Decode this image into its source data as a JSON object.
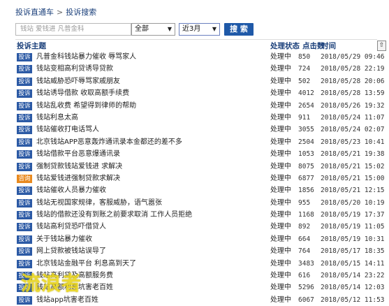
{
  "breadcrumb": {
    "root": "投诉直通车",
    "separator": ">",
    "current": "投诉搜索"
  },
  "search": {
    "placeholder": "钱站 爱钱进 凡普金科",
    "category": "全部",
    "range": "近3月",
    "button": "搜 索"
  },
  "headers": {
    "topic": "投诉主题",
    "status": "处理状态",
    "clicks": "点击数",
    "time": "时间"
  },
  "rows": [
    {
      "badge": "投诉",
      "title": "凡普金科钱站暴力催收 辱骂家人",
      "status": "处理中",
      "clicks": "850",
      "time": "2018/05/29 09:46"
    },
    {
      "badge": "投诉",
      "title": "钱站变相高利贷诱导贷款",
      "status": "处理中",
      "clicks": "724",
      "time": "2018/05/28 22:19"
    },
    {
      "badge": "投诉",
      "title": "钱站威胁恐吓辱骂家戚朋友",
      "status": "处理中",
      "clicks": "502",
      "time": "2018/05/28 20:06"
    },
    {
      "badge": "投诉",
      "title": "钱站诱导借款 收取高额手续费",
      "status": "处理中",
      "clicks": "4012",
      "time": "2018/05/28 13:59"
    },
    {
      "badge": "投诉",
      "title": "钱站乱收费 希望得到律师的帮助",
      "status": "处理中",
      "clicks": "2654",
      "time": "2018/05/26 19:32"
    },
    {
      "badge": "投诉",
      "title": "钱站利息太高",
      "status": "处理中",
      "clicks": "911",
      "time": "2018/05/24 11:07"
    },
    {
      "badge": "投诉",
      "title": "钱站催收打电话骂人",
      "status": "处理中",
      "clicks": "3055",
      "time": "2018/05/24 02:07"
    },
    {
      "badge": "投诉",
      "title": "北京钱站APP恶意轰炸通讯录本金都还的差不多",
      "status": "处理中",
      "clicks": "2504",
      "time": "2018/05/23 10:41"
    },
    {
      "badge": "投诉",
      "title": "钱站借款平台恶意爆通讯录",
      "status": "处理中",
      "clicks": "1053",
      "time": "2018/05/21 19:38"
    },
    {
      "badge": "投诉",
      "title": "强制贷款钱站爱钱进 求解决",
      "status": "处理中",
      "clicks": "8075",
      "time": "2018/05/21 15:02"
    },
    {
      "badge": "咨询",
      "title": "钱站爱钱进强制贷款求解决",
      "status": "处理中",
      "clicks": "6877",
      "time": "2018/05/21 15:00"
    },
    {
      "badge": "投诉",
      "title": "钱站催收人员暴力催收",
      "status": "处理中",
      "clicks": "1856",
      "time": "2018/05/21 12:15"
    },
    {
      "badge": "投诉",
      "title": "钱站无视国家规律，客服威胁，语气嚣张",
      "status": "处理中",
      "clicks": "955",
      "time": "2018/05/20 10:19"
    },
    {
      "badge": "投诉",
      "title": "钱站的借款还没有到账之前要求取消 工作人员拒绝",
      "status": "处理中",
      "clicks": "1168",
      "time": "2018/05/19 17:37"
    },
    {
      "badge": "投诉",
      "title": "钱站高利贷恐吓借贷人",
      "status": "处理中",
      "clicks": "892",
      "time": "2018/05/19 11:05"
    },
    {
      "badge": "投诉",
      "title": "关于钱站暴力催收",
      "status": "处理中",
      "clicks": "664",
      "time": "2018/05/19 10:31"
    },
    {
      "badge": "投诉",
      "title": "网上贷款被钱站误导了",
      "status": "处理中",
      "clicks": "764",
      "time": "2018/05/17 18:35"
    },
    {
      "badge": "投诉",
      "title": "北京钱站金融平台 利息高到天了",
      "status": "处理中",
      "clicks": "3483",
      "time": "2018/05/15 14:11"
    },
    {
      "badge": "投诉",
      "title": "钱站高利贷及高额服务费",
      "status": "处理中",
      "clicks": "616",
      "time": "2018/05/14 23:22"
    },
    {
      "badge": "投诉",
      "title": "钱站高额利息坑害老百姓",
      "status": "处理中",
      "clicks": "5296",
      "time": "2018/05/14 12:03"
    },
    {
      "badge": "投诉",
      "title": "钱站app坑害老百姓",
      "status": "处理中",
      "clicks": "6067",
      "time": "2018/05/12 11:53"
    }
  ],
  "watermark": "流浪者",
  "colors": {
    "badge_blue": "#2c5aa5",
    "badge_orange": "#e98a1f",
    "button": "#1f59a8",
    "header_text": "#1a3f7a"
  }
}
